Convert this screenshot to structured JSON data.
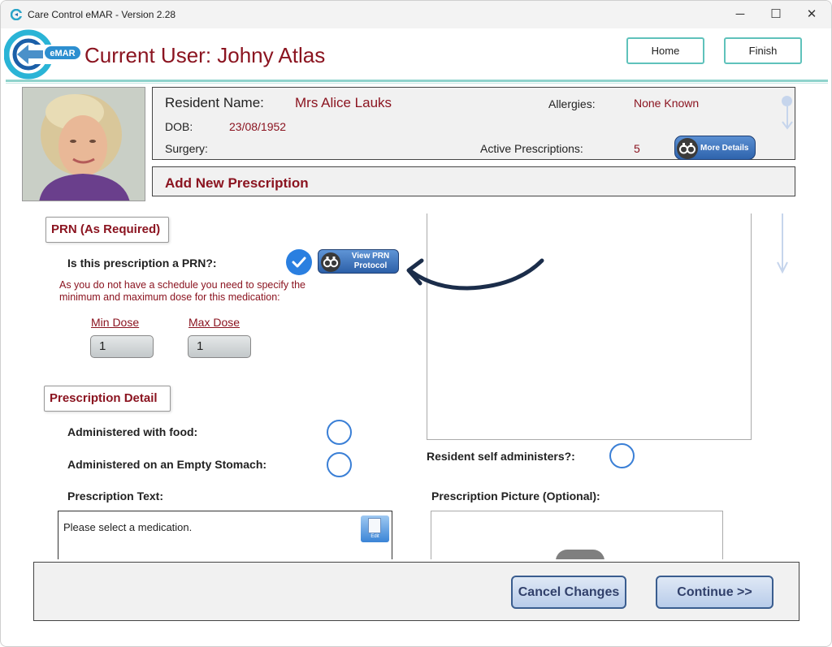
{
  "window": {
    "title": "Care Control eMAR - Version 2.28",
    "controls": {
      "minimize": "─",
      "maximize": "☐",
      "close": "✕"
    }
  },
  "header": {
    "logo_text": "eMAR",
    "current_user": "Current User: Johny Atlas",
    "home_label": "Home",
    "finish_label": "Finish"
  },
  "resident": {
    "name_label": "Resident Name:",
    "name": "Mrs Alice Lauks",
    "allergies_label": "Allergies:",
    "allergies": "None Known",
    "dob_label": "DOB:",
    "dob": "23/08/1952",
    "surgery_label": "Surgery:",
    "surgery": "",
    "active_label": "Active Prescriptions:",
    "active_count": "5",
    "more_details_label": "More Details"
  },
  "add_prescription": {
    "title": "Add New Prescription"
  },
  "prn": {
    "section_title": "PRN (As Required)",
    "question": "Is this prescription a PRN?:",
    "checked": true,
    "view_protocol_label_1": "View PRN",
    "view_protocol_label_2": "Protocol",
    "note": "As you do not have a schedule you need to specify the minimum and maximum dose for this medication:",
    "min_dose_label": "Min Dose",
    "min_dose": "1",
    "max_dose_label": "Max Dose",
    "max_dose": "1"
  },
  "detail": {
    "section_title": "Prescription Detail",
    "with_food_label": "Administered with food:",
    "empty_stomach_label": "Administered on an Empty Stomach:",
    "self_administers_label": "Resident self administers?:",
    "text_label": "Prescription Text:",
    "text_value": "Please select a medication.",
    "edit_label": "Edit",
    "picture_label": "Prescription Picture (Optional):"
  },
  "footer": {
    "cancel_label": "Cancel Changes",
    "continue_label": "Continue >>"
  },
  "colors": {
    "accent_red": "#8b1420",
    "teal": "#5fc2bb",
    "blue": "#2a7fe0"
  }
}
